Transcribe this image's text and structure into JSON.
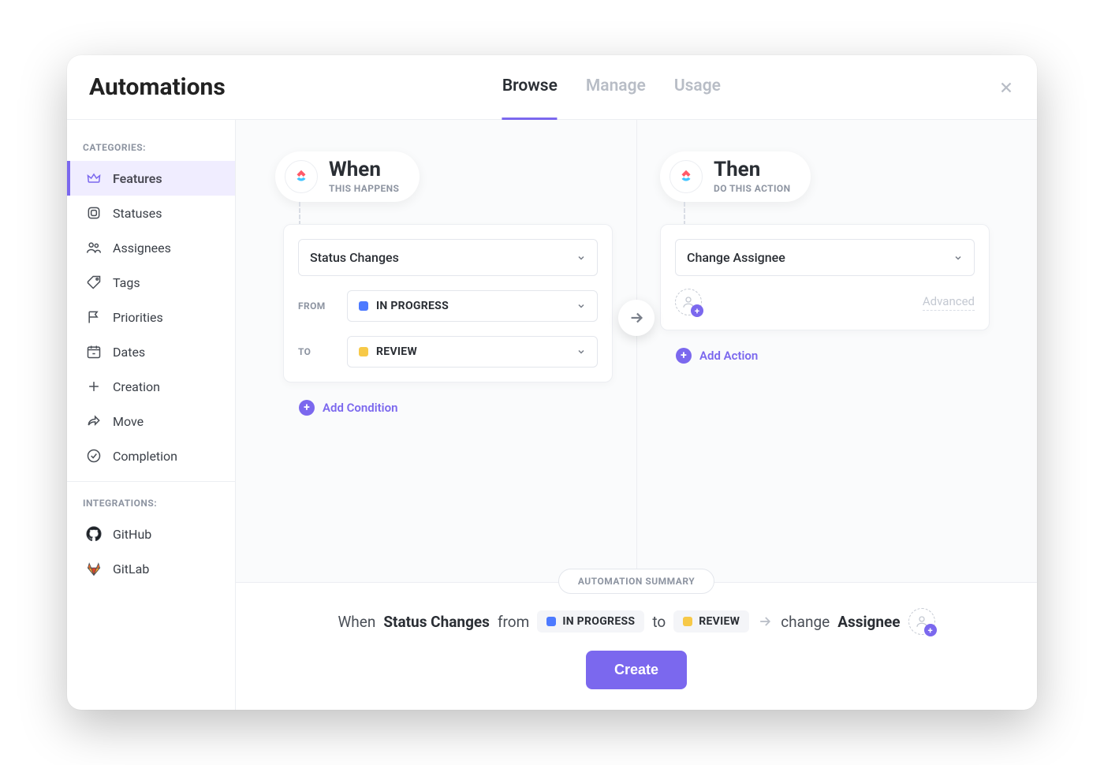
{
  "modal": {
    "title": "Automations",
    "tabs": [
      "Browse",
      "Manage",
      "Usage"
    ],
    "active_tab": 0
  },
  "sidebar": {
    "categories_heading": "CATEGORIES:",
    "integrations_heading": "INTEGRATIONS:",
    "items": [
      {
        "label": "Features",
        "icon": "crown-icon"
      },
      {
        "label": "Statuses",
        "icon": "square-icon"
      },
      {
        "label": "Assignees",
        "icon": "people-icon"
      },
      {
        "label": "Tags",
        "icon": "tag-icon"
      },
      {
        "label": "Priorities",
        "icon": "flag-icon"
      },
      {
        "label": "Dates",
        "icon": "calendar-icon"
      },
      {
        "label": "Creation",
        "icon": "plus-square-icon"
      },
      {
        "label": "Move",
        "icon": "share-arrow-icon"
      },
      {
        "label": "Completion",
        "icon": "check-circle-icon"
      }
    ],
    "active_item": 0,
    "integrations": [
      {
        "label": "GitHub",
        "icon": "github-icon"
      },
      {
        "label": "GitLab",
        "icon": "gitlab-icon"
      }
    ]
  },
  "colors": {
    "accent": "#7b68ee",
    "status_in_progress": "#4d7aff",
    "status_review": "#f7c948"
  },
  "when": {
    "title": "When",
    "subtitle": "THIS HAPPENS",
    "trigger": "Status Changes",
    "from_label": "FROM",
    "to_label": "TO",
    "from_status": "IN PROGRESS",
    "to_status": "REVIEW",
    "add_condition": "Add Condition"
  },
  "then": {
    "title": "Then",
    "subtitle": "DO THIS ACTION",
    "action": "Change Assignee",
    "advanced": "Advanced",
    "add_action": "Add Action"
  },
  "summary": {
    "heading": "AUTOMATION SUMMARY",
    "when_word": "When",
    "trigger": "Status Changes",
    "from_word": "from",
    "from_status": "IN PROGRESS",
    "to_word": "to",
    "to_status": "REVIEW",
    "action_word": "change",
    "action_target": "Assignee",
    "create_button": "Create"
  }
}
